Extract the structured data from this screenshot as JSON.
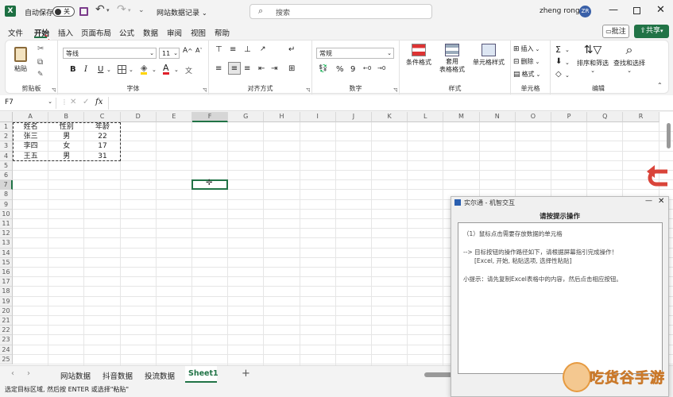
{
  "titlebar": {
    "autosave": "自动保存",
    "autosave_state": "关",
    "filename": "网站数据记录",
    "search_placeholder": "搜索",
    "user": "zheng rong",
    "avatar": "ZR"
  },
  "menu": {
    "items": [
      "文件",
      "开始",
      "插入",
      "页面布局",
      "公式",
      "数据",
      "审阅",
      "视图",
      "帮助"
    ],
    "comment": "批注",
    "share": "共享"
  },
  "ribbon": {
    "clipboard": {
      "label": "剪贴板",
      "paste": "粘贴"
    },
    "font": {
      "label": "字体",
      "name": "等线",
      "size": "11",
      "bold": "B",
      "italic": "I",
      "underline": "U"
    },
    "align": {
      "label": "对齐方式"
    },
    "number": {
      "label": "数字",
      "format": "常规"
    },
    "styles": {
      "label": "样式",
      "cond": "条件格式",
      "table": "套用\n表格格式",
      "cellstyle": "单元格样式"
    },
    "cells": {
      "label": "单元格",
      "insert": "插入",
      "delete": "删除",
      "format": "格式"
    },
    "edit": {
      "label": "编辑",
      "sort": "排序和筛选",
      "find": "查找和选择"
    }
  },
  "formula": {
    "namebox": "F7",
    "fx": "fx"
  },
  "columns": [
    "A",
    "B",
    "C",
    "D",
    "E",
    "F",
    "G",
    "H",
    "I",
    "J",
    "K",
    "L",
    "M",
    "N",
    "O",
    "P",
    "Q",
    "R"
  ],
  "rows": [
    "1",
    "2",
    "3",
    "4",
    "5",
    "6",
    "7",
    "8",
    "9",
    "10",
    "11",
    "12",
    "13",
    "14",
    "15",
    "16",
    "17",
    "18",
    "19",
    "20",
    "21",
    "22",
    "23",
    "24",
    "25"
  ],
  "table": [
    [
      "姓名",
      "性别",
      "年龄"
    ],
    [
      "张三",
      "男",
      "22"
    ],
    [
      "李四",
      "女",
      "17"
    ],
    [
      "王五",
      "男",
      "31"
    ]
  ],
  "sheets": [
    "网站数据",
    "抖音数据",
    "投流数据",
    "Sheet1"
  ],
  "status": "选定目标区域, 然后按 ENTER 或选择\"粘贴\"",
  "dialog": {
    "title": "实尔通 - 机智交互",
    "heading": "请按提示操作",
    "line1": "（1）鼠标点击需要存放数据的单元格",
    "line2": "--> 目标按钮的操作路径如下，请根据屏幕指引完成操作！",
    "line3": "[Excel, 开始, 粘贴选项, 选择性粘贴]",
    "line4": "小提示：请先复制Excel表格中的内容，然后点击相应按钮。"
  },
  "watermark": "吃货谷手游",
  "colors": {
    "accent": "#217346",
    "red_arrow": "#e0202a",
    "undo": "#d9443a"
  }
}
